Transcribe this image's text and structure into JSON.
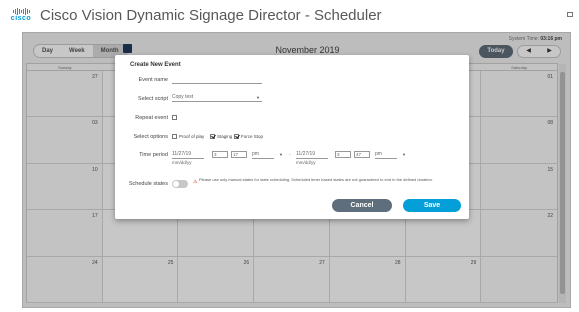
{
  "header": {
    "title": "Cisco Vision Dynamic Signage Director - Scheduler",
    "logo_text": "cisco"
  },
  "calendar": {
    "system_time_label": "System Time:",
    "system_time": "03:16 pm",
    "views": [
      "Day",
      "Week",
      "Month"
    ],
    "active_view": "Month",
    "month_title": "November 2019",
    "today_label": "Today",
    "prev_label": "◀",
    "next_label": "▶",
    "weekdays": [
      "Sunday",
      "",
      "",
      "",
      "",
      "",
      "Saturday"
    ],
    "weeks": [
      [
        "27",
        "",
        "",
        "",
        "",
        "",
        "01"
      ],
      [
        "03",
        "",
        "",
        "",
        "",
        "",
        "08"
      ],
      [
        "10",
        "",
        "",
        "",
        "",
        "",
        "15"
      ],
      [
        "17",
        "",
        "",
        "",
        "",
        "",
        "22"
      ],
      [
        "24",
        "25",
        "26",
        "27",
        "28",
        "29",
        ""
      ]
    ]
  },
  "modal": {
    "title": "Create New Event",
    "event_name_label": "Event name",
    "event_name_value": "",
    "script_label": "Select script",
    "script_value": "Copy test",
    "repeat_label": "Repeat event",
    "repeat_checked": false,
    "options_label": "Select options",
    "options": [
      {
        "label": "Proof of play",
        "checked": false
      },
      {
        "label": "Staging",
        "checked": true
      },
      {
        "label": "Force Stop",
        "checked": true
      }
    ],
    "time_period_label": "Time period",
    "start": {
      "date": "11/27/19",
      "date_hint": "mm/dd/yy",
      "hour": "3",
      "minute": "17",
      "ampm": "pm"
    },
    "range_sep": "-",
    "end": {
      "date": "11/27/19",
      "date_hint": "mm/dd/yy",
      "hour": "3",
      "minute": "47",
      "ampm": "pm"
    },
    "schedule_states_label": "Schedule states",
    "schedule_states_on": false,
    "warning": "Please use only manual states for state scheduling. Scheduled timer based states are not guaranteed to end in the defined duration.",
    "cancel_label": "Cancel",
    "save_label": "Save"
  }
}
